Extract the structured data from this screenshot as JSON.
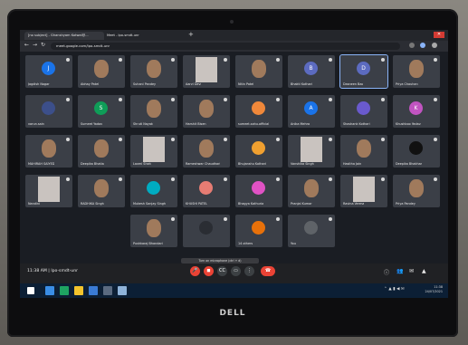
{
  "browser": {
    "tab1_title": "[no subject] - Ghanshyam Kotwal@...",
    "tab2_title": "Meet - lpo-smdt-unr",
    "url": "meet.google.com/lpo-smdt-unr"
  },
  "participants": [
    {
      "name": "Jagdish Nagar",
      "initial": "J",
      "color": "#1a73e8",
      "video": false
    },
    {
      "name": "Abhay Patel",
      "initial": "",
      "color": "",
      "video": true
    },
    {
      "name": "Suhani Pandey",
      "initial": "",
      "color": "",
      "video": true
    },
    {
      "name": "Aarvi Devi",
      "initial": "",
      "color": "",
      "video": true
    },
    {
      "name": "Nitin Patel",
      "initial": "",
      "color": "",
      "video": true
    },
    {
      "name": "Bhakti Kothari",
      "initial": "B",
      "color": "#5c6bc0",
      "video": false
    },
    {
      "name": "Dasneen Bao",
      "initial": "D",
      "color": "#5c6bc0",
      "video": false,
      "selected": true
    },
    {
      "name": "Priya Chauhan",
      "initial": "",
      "color": "",
      "video": true
    },
    {
      "name": "varun.sain",
      "initial": "",
      "color": "#3c4f8a",
      "video": false
    },
    {
      "name": "Sumeet Yadav",
      "initial": "S",
      "color": "#0f9d58",
      "video": false
    },
    {
      "name": "Shruti Nayak",
      "initial": "",
      "color": "",
      "video": true
    },
    {
      "name": "Harshit Bisen",
      "initial": "",
      "color": "",
      "video": true
    },
    {
      "name": "sumeet.sahu.official",
      "initial": "",
      "color": "#f0883a",
      "video": false
    },
    {
      "name": "Anika Mehra",
      "initial": "A",
      "color": "#1a73e8",
      "video": false
    },
    {
      "name": "Shashank Kothari",
      "initial": "",
      "color": "#6a5acd",
      "video": false
    },
    {
      "name": "Khushboo Yadav",
      "initial": "K",
      "color": "#c154c1",
      "video": false
    },
    {
      "name": "MAHIRAH SAIYED",
      "initial": "",
      "color": "",
      "video": true
    },
    {
      "name": "Deepika Bhatia",
      "initial": "",
      "color": "",
      "video": true
    },
    {
      "name": "Laxmi Shah",
      "initial": "",
      "color": "",
      "video": true
    },
    {
      "name": "Rameshwar Chaudhari",
      "initial": "",
      "color": "",
      "video": true
    },
    {
      "name": "Bhujanshu Kothari",
      "initial": "",
      "color": "#f0a030",
      "video": false
    },
    {
      "name": "Vanshika Singh",
      "initial": "",
      "color": "",
      "video": true
    },
    {
      "name": "Hasitha Jain",
      "initial": "",
      "color": "",
      "video": true
    },
    {
      "name": "Deepika Bhakhar",
      "initial": "",
      "color": "#111111",
      "video": false
    },
    {
      "name": "Nandini",
      "initial": "",
      "color": "",
      "video": true
    },
    {
      "name": "RADHIKA Singh",
      "initial": "",
      "color": "",
      "video": true
    },
    {
      "name": "Mukesh Sanjay Singh",
      "initial": "",
      "color": "#00acc1",
      "video": false
    },
    {
      "name": "KHUSHI PATEL",
      "initial": "",
      "color": "#e67c73",
      "video": false
    },
    {
      "name": "Bhagya Kathuria",
      "initial": "",
      "color": "#e052c4",
      "video": false
    },
    {
      "name": "Pranjal Kumar",
      "initial": "",
      "color": "",
      "video": true
    },
    {
      "name": "Ravina Verma",
      "initial": "",
      "color": "",
      "video": true
    },
    {
      "name": "Priya Pandey",
      "initial": "",
      "color": "",
      "video": true
    },
    {
      "name": "Pushkaraj Bhandari",
      "initial": "",
      "color": "",
      "video": true
    },
    {
      "name": "",
      "initial": "",
      "color": "#2a2d33",
      "video": false
    },
    {
      "name": "14 others",
      "initial": "",
      "color": "#e8710a",
      "video": false
    },
    {
      "name": "You",
      "initial": "",
      "color": "#5f6368",
      "video": false
    }
  ],
  "meeting": {
    "time": "11:38 AM",
    "separator": "|",
    "code": "lpo-smdt-unr",
    "tooltip": "Turn on microphone (ctrl + d)"
  },
  "taskbar": {
    "clock": "11:38",
    "date": "24/07/2021"
  },
  "brand": "DELL",
  "colors": {
    "accent": "#1a73e8",
    "end_call": "#ea4335"
  }
}
